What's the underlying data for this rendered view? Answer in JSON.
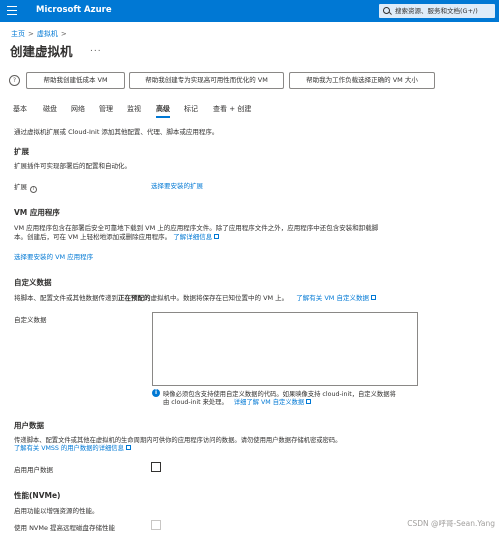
{
  "topbar": {
    "brand": "Microsoft Azure",
    "search_placeholder": "搜索资源、服务和文档(G+/)"
  },
  "breadcrumb": {
    "home": "主页",
    "sep": ">",
    "current": "虚拟机",
    "sep2": ">"
  },
  "page": {
    "title": "创建虚拟机",
    "more": "..."
  },
  "help_buttons": [
    "帮助我创建低成本 VM",
    "帮助我创建专为实现高可用性而优化的 VM",
    "帮助我为工作负载选择正确的 VM 大小"
  ],
  "tabs": [
    "基本",
    "磁盘",
    "网络",
    "管理",
    "监视",
    "高级",
    "标记",
    "查看 + 创建"
  ],
  "active_tab": "高级",
  "intro": "通过虚拟机扩展或 Cloud-Init 添加其他配置、代理、脚本或应用程序。",
  "extensions": {
    "heading": "扩展",
    "desc": "扩展插件可实现部署后的配置和自动化。",
    "label": "扩展",
    "link": "选择要安装的扩展"
  },
  "vm_apps": {
    "heading": "VM 应用程序",
    "desc1": "VM 应用程序包含在部署后安全可靠地下载到 VM 上的应用程序文件。除了应用程序文件之外，应用程序中还包含安装和卸载脚",
    "desc2": "本。创建后，可在 VM 上轻松地添加或删除应用程序。",
    "learn_more": "了解详细信息",
    "link": "选择要安装的 VM 应用程序"
  },
  "custom_data": {
    "heading": "自定义数据",
    "desc_pre": "将脚本、配置文件或其他数据传递到",
    "desc_bold": "正在预配的",
    "desc_post": "虚拟机中。数据将保存在已知位置中的 VM 上。",
    "learn_more": "了解有关 VM 自定义数据",
    "label": "自定义数据",
    "value": "",
    "info1": "映像必须包含支持使用自定义数据的代码。如果映像支持 cloud-init，自定义数据将",
    "info2": "由 cloud-init 来处理。",
    "info_link": "详细了解 VM 自定义数据"
  },
  "user_data": {
    "heading": "用户数据",
    "desc": "传递脚本、配置文件或其他在虚拟机的生命周期内可供你的应用程序访问的数据。请勿使用用户数据存储机密或密码。",
    "learn_more": "了解有关 VMSS 的用户数据的详细信息",
    "label": "启用用户数据"
  },
  "performance": {
    "heading": "性能(NVMe)",
    "desc": "启用功能以增强资源的性能。",
    "label": "使用 NVMe 提高远程磁盘存储性能"
  },
  "watermark": "CSDN @呼哥-Sean.Yang"
}
